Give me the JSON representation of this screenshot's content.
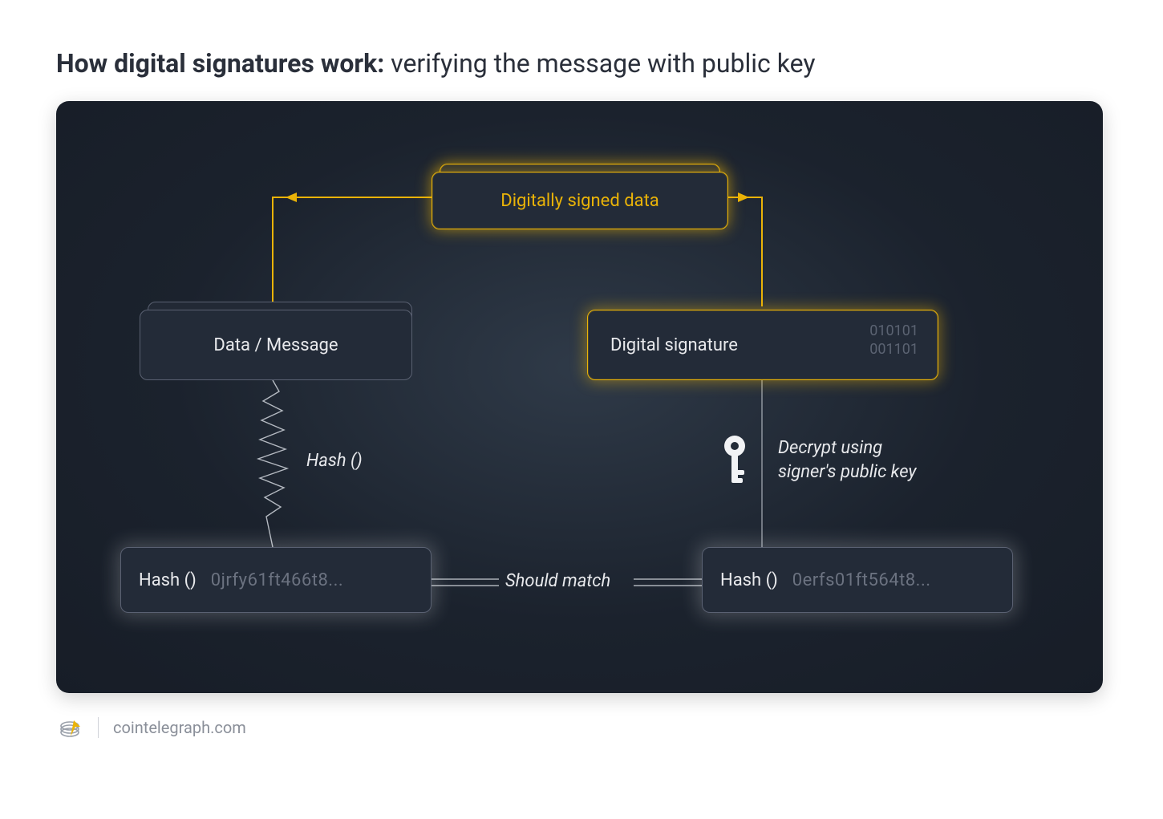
{
  "title": {
    "bold": "How digital signatures work:",
    "light": " verifying the message with public key"
  },
  "nodes": {
    "signed": {
      "label": "Digitally signed data"
    },
    "message": {
      "label": "Data / Message"
    },
    "signature": {
      "label": "Digital signature",
      "binary_top": "010101",
      "binary_bottom": "001101"
    },
    "hash_left": {
      "label": "Hash ()",
      "value": "0jrfy61ft466t8..."
    },
    "hash_right": {
      "label": "Hash ()",
      "value": "0erfs01ft564t8..."
    }
  },
  "annotations": {
    "hash_fn": "Hash ()",
    "decrypt_l1": "Decrypt using",
    "decrypt_l2": "signer's public key",
    "match": "Should match"
  },
  "footer": {
    "site": "cointelegraph.com"
  },
  "colors": {
    "gold": "#eab308",
    "panel": "#1f2734"
  }
}
